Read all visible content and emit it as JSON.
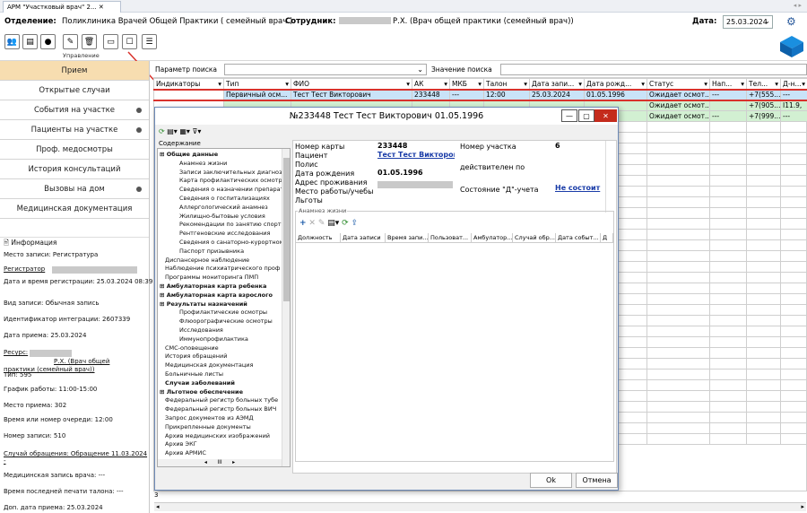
{
  "app": {
    "tab_title": "АРМ \"Участковый врач\" 2..."
  },
  "header": {
    "dept_label": "Отделение:",
    "dept_value": "Поликлиника Врачей Общей Практики ( семейный врач )",
    "staff_label": "Сотрудник:",
    "staff_value": "Р.Х. (Врач общей практики (семейный врач))",
    "date_label": "Дата:",
    "date_value": "25.03.2024"
  },
  "toolbar": {
    "group_label": "Управление"
  },
  "left_nav": [
    {
      "label": "Прием",
      "active": true,
      "dot": false
    },
    {
      "label": "Открытые случаи",
      "dot": false
    },
    {
      "label": "События на участке",
      "dot": true
    },
    {
      "label": "Пациенты на участке",
      "dot": true
    },
    {
      "label": "Проф. медосмотры",
      "dot": false
    },
    {
      "label": "История консультаций",
      "dot": false
    },
    {
      "label": "Вызовы на дом",
      "dot": true
    },
    {
      "label": "Медицинская документация",
      "dot": false
    }
  ],
  "info": {
    "title": "Информация",
    "lines": [
      "Место записи: Регистратура",
      "Регистратор",
      "Дата и время регистрации: 25.03.2024 08:39",
      "Вид записи: Обычная запись",
      "Идентификатор интеграции: 2607339",
      "Дата приема: 25.03.2024",
      "Ресурс:",
      "Р.Х. (Врач общей",
      "практики (семейный врач))",
      "Тип: 595",
      "График работы: 11:00-15:00",
      "Место приема: 302",
      "Время или номер очереди: 12:00",
      "Номер записи: 510",
      "Случай обращения: Обращение 11.03.2024",
      "-",
      "Медицинская запись врача: ---",
      "Время последней печати талона: ---",
      "Доп. дата приема: 25.03.2024"
    ]
  },
  "search": {
    "param_label": "Параметр поиска",
    "value_label": "Значение поиска"
  },
  "grid": {
    "headers": [
      "Индикаторы",
      "Тип",
      "ФИО",
      "АК",
      "МКБ",
      "Талон",
      "Дата запи...",
      "Дата рожд...",
      "Статус",
      "Нап...",
      "Тел...",
      "Д-н..."
    ],
    "rows": [
      [
        "",
        "Первичный осм...",
        "Тест Тест Викторович",
        "233448",
        "---",
        "12:00",
        "25.03.2024",
        "01.05.1996",
        "Ожидает осмот...",
        "---",
        "+7(555...",
        "---"
      ],
      [
        "",
        "",
        "",
        "",
        "",
        "",
        "",
        "",
        "Ожидает осмот...",
        "",
        "+7(905...",
        "I11.9,"
      ],
      [
        "",
        "",
        "",
        "",
        "",
        "",
        "",
        "",
        "Ожидает осмот...",
        "---",
        "+7(999...",
        "---"
      ]
    ],
    "footer_value": "3"
  },
  "dialog": {
    "title": "№233448 Тест Тест Викторович 01.05.1996",
    "tree_header": "Содержание",
    "tree": [
      {
        "t": "Общие данные",
        "b": true,
        "l": 0
      },
      {
        "t": "Анамнез жизни",
        "l": 2
      },
      {
        "t": "Записи заключительных диагноз",
        "l": 2
      },
      {
        "t": "Карта профилактических осмотр",
        "l": 2
      },
      {
        "t": "Сведения о назначении препарат",
        "l": 2
      },
      {
        "t": "Сведения о госпитализациях",
        "l": 2
      },
      {
        "t": "Аллергологический анамнез",
        "l": 2
      },
      {
        "t": "Жилищно-бытовые условия",
        "l": 2
      },
      {
        "t": "Рекомендации по занятию спорт",
        "l": 2
      },
      {
        "t": "Рентгеновские исследования",
        "l": 2
      },
      {
        "t": "Сведения о санаторно-курортном",
        "l": 2
      },
      {
        "t": "Паспорт призывника",
        "l": 2
      },
      {
        "t": "Диспансерное наблюдение",
        "l": 1
      },
      {
        "t": "Наблюдение психиатрического проф",
        "l": 1
      },
      {
        "t": "Программы мониторинга ПМП",
        "l": 1
      },
      {
        "t": "Амбулаторная карта ребенка",
        "b": true,
        "l": 0
      },
      {
        "t": "Амбулаторная карта взрослого",
        "b": true,
        "l": 0
      },
      {
        "t": "Результаты назначений",
        "b": true,
        "l": 0
      },
      {
        "t": "Профилактические осмотры",
        "l": 2
      },
      {
        "t": "Флюорографические осмотры",
        "l": 2
      },
      {
        "t": "Исследования",
        "l": 2
      },
      {
        "t": "Иммунопрофилактика",
        "l": 2
      },
      {
        "t": "СМС-оповещение",
        "l": 1
      },
      {
        "t": "История обращений",
        "l": 1
      },
      {
        "t": "Медицинская документация",
        "l": 1
      },
      {
        "t": "Больничные листы",
        "l": 1
      },
      {
        "t": "Случаи заболеваний",
        "b": true,
        "l": 1
      },
      {
        "t": "Льготное обеспечение",
        "b": true,
        "l": 0
      },
      {
        "t": "Федеральный регистр больных тубе",
        "l": 1
      },
      {
        "t": "Федеральный регистр больных ВИЧ",
        "l": 1
      },
      {
        "t": "Запрос документов из АЭМД",
        "l": 1
      },
      {
        "t": "Прикрепленные документы",
        "l": 1
      },
      {
        "t": "Архив медицинских изображений",
        "l": 1
      },
      {
        "t": "Архив ЭКГ",
        "l": 1
      },
      {
        "t": "Архив АРМИС",
        "l": 1
      }
    ],
    "card_label": "Номер карты",
    "card_value": "233448",
    "patient_label": "Пациент",
    "patient_value": "Тест Тест Викторови",
    "policy_label": "Полис",
    "dob_label": "Дата рождения",
    "dob_value": "01.05.1996",
    "address_label": "Адрес проживания",
    "work_label": "Место работы/учебы",
    "benefits_label": "Льготы",
    "area_label": "Номер участка",
    "area_value": "6",
    "valid_label": "действителен по",
    "d_label": "Состояние \"Д\"-учета",
    "d_value": "Не состоит",
    "section_label": "Анамнез жизни",
    "table_headers": [
      "Должность",
      "Дата записи",
      "Время запи...",
      "Пользоват...",
      "Амбулатор...",
      "Случай обр...",
      "Дата событ...",
      "Д"
    ],
    "ok_label": "Ok",
    "cancel_label": "Отмена"
  }
}
